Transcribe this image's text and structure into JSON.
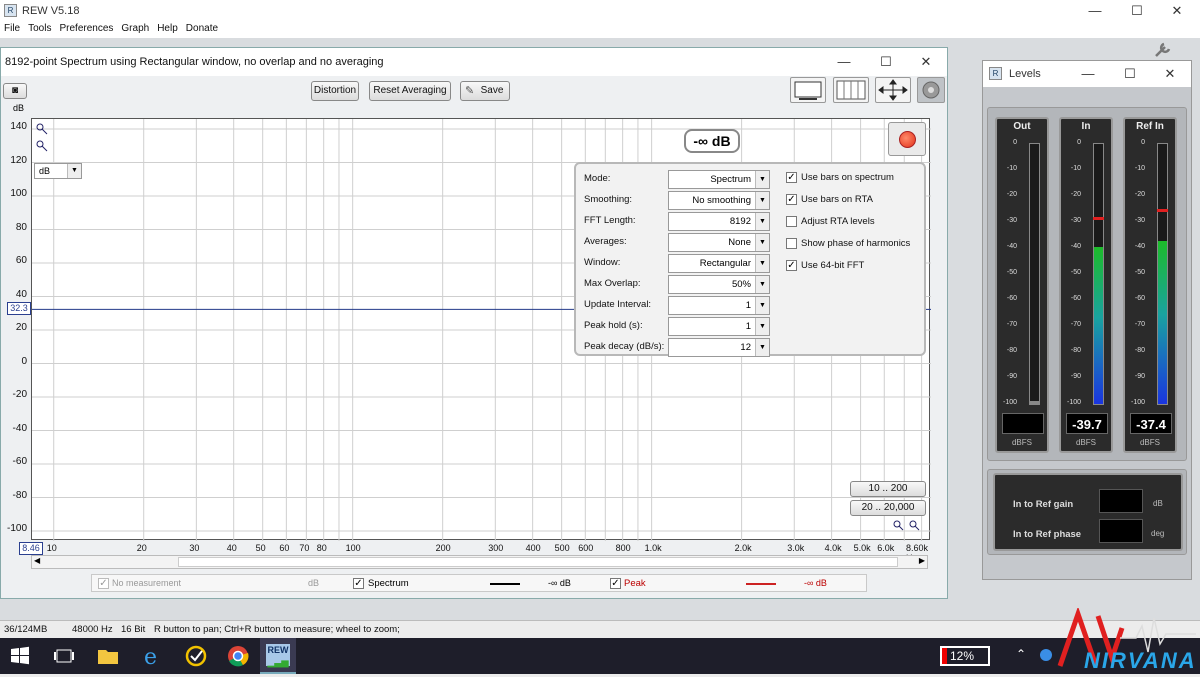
{
  "app": {
    "title": "REW V5.18",
    "menu": [
      "File",
      "Tools",
      "Preferences",
      "Graph",
      "Help",
      "Donate"
    ]
  },
  "window_controls": {
    "minimize": "—",
    "maximize": "☐",
    "close": "✕"
  },
  "spectrum": {
    "title": "8192-point Spectrum using Rectangular window, no overlap and no averaging",
    "buttons": {
      "distortion": "Distortion",
      "reset_averaging": "Reset Averaging",
      "save": "Save"
    },
    "unit_select": "dB",
    "db_readout": "-∞ dB",
    "cursor_y": "32.3",
    "cursor_x": "8.46",
    "y_axis_label": "dB",
    "range_buttons": {
      "narrow": "10 .. 200",
      "wide": "20 .. 20,000"
    },
    "controls": [
      {
        "label": "Mode:",
        "value": "Spectrum"
      },
      {
        "label": "Smoothing:",
        "value": "No  smoothing"
      },
      {
        "label": "FFT Length:",
        "value": "8192"
      },
      {
        "label": "Averages:",
        "value": "None"
      },
      {
        "label": "Window:",
        "value": "Rectangular"
      },
      {
        "label": "Max Overlap:",
        "value": "50%"
      },
      {
        "label": "Update Interval:",
        "value": "1"
      },
      {
        "label": "Peak hold (s):",
        "value": "1"
      },
      {
        "label": "Peak decay (dB/s):",
        "value": "12"
      }
    ],
    "checkboxes": [
      {
        "label": "Use bars on spectrum",
        "checked": true
      },
      {
        "label": "Use bars on RTA",
        "checked": true
      },
      {
        "label": "Adjust RTA levels",
        "checked": false
      },
      {
        "label": "Show phase of harmonics",
        "checked": false
      },
      {
        "label": "Use 64-bit FFT",
        "checked": true
      }
    ],
    "legend": {
      "no_measurement": "No measurement",
      "no_measurement_unit": "dB",
      "spectrum": "Spectrum",
      "spectrum_value": "-∞ dB",
      "peak": "Peak",
      "peak_value": "-∞ dB"
    }
  },
  "chart_data": {
    "type": "line",
    "ylabel": "dB",
    "xlabel": "Hz",
    "ylim": [
      -100,
      140
    ],
    "y_ticks": [
      "140",
      "120",
      "100",
      "80",
      "60",
      "40",
      "20",
      "0",
      "-20",
      "-40",
      "-60",
      "-80",
      "-100"
    ],
    "x_ticks": [
      "10",
      "20",
      "30",
      "40",
      "50",
      "60",
      "70",
      "80",
      "100",
      "200",
      "300",
      "400",
      "500",
      "600",
      "800",
      "1.0k",
      "2.0k",
      "3.0k",
      "4.0k",
      "5.0k",
      "6.0k",
      "8.60k Hz"
    ],
    "x_scale": "log",
    "grid": true,
    "series": []
  },
  "levels": {
    "title": "Levels",
    "meters": [
      {
        "title": "Out",
        "value": "",
        "unit": "dBFS",
        "level_db": -100
      },
      {
        "title": "In",
        "value": "-39.7",
        "unit": "dBFS",
        "level_db": -39.7,
        "peak_db": -28
      },
      {
        "title": "Ref In",
        "value": "-37.4",
        "unit": "dBFS",
        "level_db": -37.4,
        "peak_db": -25
      }
    ],
    "scale": [
      "0",
      "-10",
      "-20",
      "-30",
      "-40",
      "-50",
      "-60",
      "-70",
      "-80",
      "-90",
      "-100"
    ],
    "gain_label": "In to Ref gain",
    "gain_unit": "dB",
    "phase_label": "In to Ref phase",
    "phase_unit": "deg"
  },
  "status": {
    "memory": "36/124MB",
    "sample_rate": "48000 Hz",
    "bit_depth": "16 Bit",
    "hint": "R button to pan; Ctrl+R button to measure; wheel to zoom;"
  },
  "taskbar": {
    "battery": "12%",
    "watermark_top": "AV",
    "watermark_bottom": "NIRVANA"
  }
}
